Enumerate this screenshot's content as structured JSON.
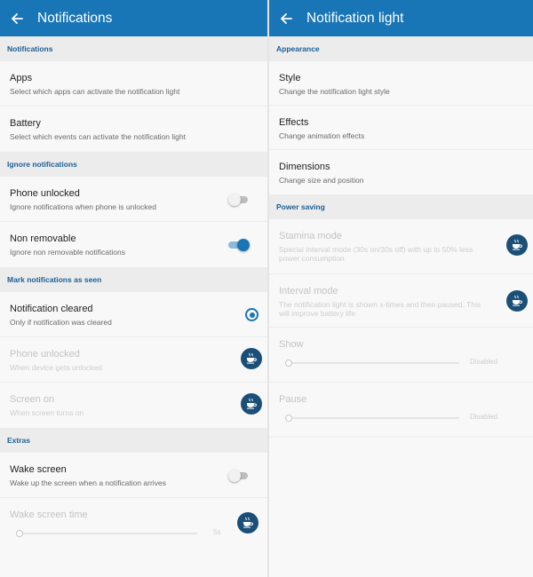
{
  "left": {
    "title": "Notifications",
    "section_notifications": "Notifications",
    "apps": {
      "title": "Apps",
      "subtitle": "Select which apps can activate the notification light"
    },
    "battery": {
      "title": "Battery",
      "subtitle": "Select which events can activate the notification light"
    },
    "section_ignore": "Ignore notifications",
    "phone_unlocked_ignore": {
      "title": "Phone unlocked",
      "subtitle": "Ignore notifications when phone is unlocked",
      "enabled": false
    },
    "non_removable": {
      "title": "Non removable",
      "subtitle": "Ignore non removable notifications",
      "enabled": true
    },
    "section_mark_seen": "Mark notifications as seen",
    "notification_cleared": {
      "title": "Notification cleared",
      "subtitle": "Only if notification was cleared",
      "selected": true
    },
    "phone_unlocked_seen": {
      "title": "Phone unlocked",
      "subtitle": "When device gets unlocked"
    },
    "screen_on": {
      "title": "Screen on",
      "subtitle": "When screen turns on"
    },
    "section_extras": "Extras",
    "wake_screen": {
      "title": "Wake screen",
      "subtitle": "Wake up the screen when a notification arrives",
      "enabled": false
    },
    "wake_screen_time": {
      "title": "Wake screen time",
      "value": "5s",
      "level": 0
    }
  },
  "right": {
    "title": "Notification light",
    "section_appearance": "Appearance",
    "style": {
      "title": "Style",
      "subtitle": "Change the notification light style"
    },
    "effects": {
      "title": "Effects",
      "subtitle": "Change animation effects"
    },
    "dimensions": {
      "title": "Dimensions",
      "subtitle": "Change size and position"
    },
    "section_power": "Power saving",
    "stamina": {
      "title": "Stamina mode",
      "subtitle": "Special interval mode (30s on/30s off) with up to 50% less power consumption"
    },
    "interval": {
      "title": "Interval mode",
      "subtitle": "The notification light is shown x-times and then paused. This will improve battery life"
    },
    "show": {
      "title": "Show",
      "value": "Disabled",
      "level": 0
    },
    "pause": {
      "title": "Pause",
      "value": "Disabled",
      "level": 0
    }
  },
  "colors": {
    "accent": "#1876b6",
    "section_text": "#1b5f94",
    "badge": "#1b4f78"
  },
  "icons": {
    "back": "arrow-left-icon",
    "pro": "coffee-cup-icon"
  }
}
